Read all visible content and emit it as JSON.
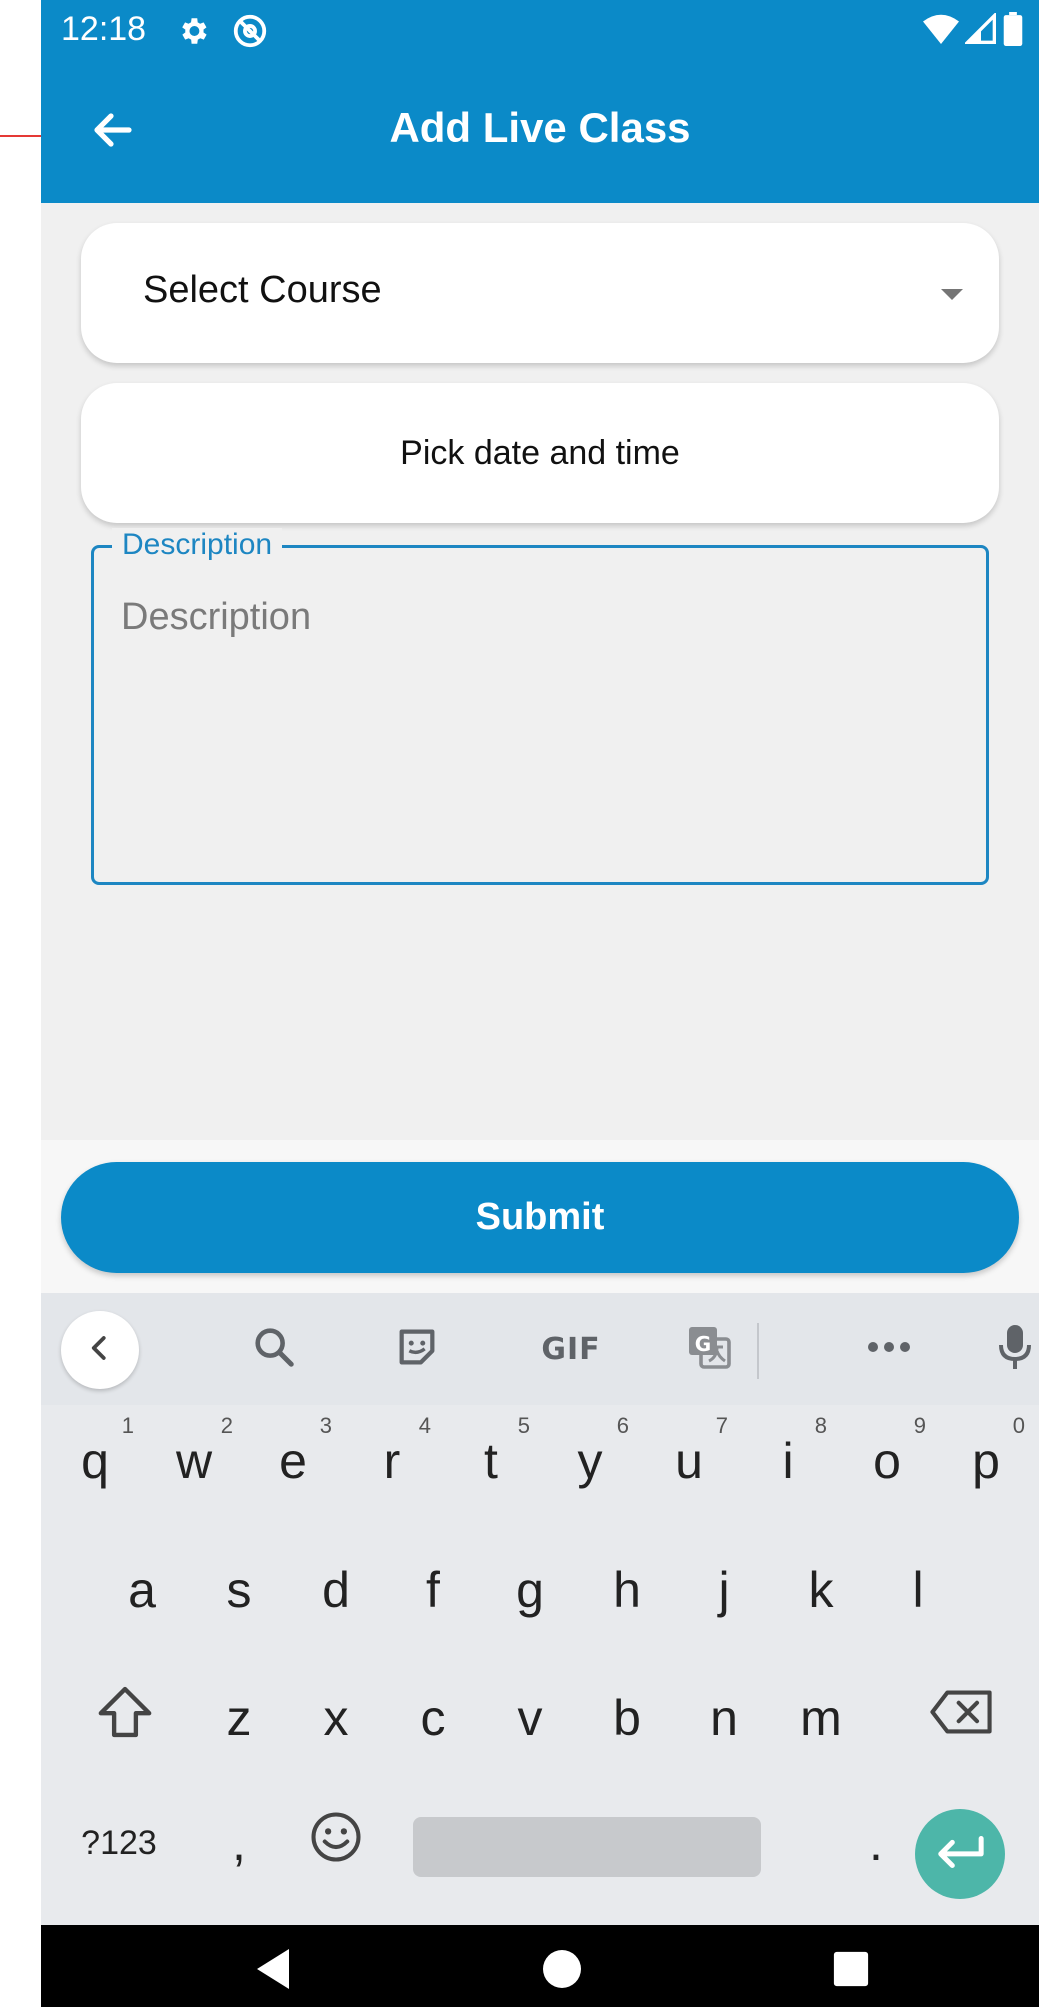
{
  "status_bar": {
    "time": "12:18",
    "left_icons": [
      "gear-icon",
      "at-sign-icon"
    ],
    "right_icons": [
      "wifi-icon",
      "signal-icon",
      "battery-icon"
    ]
  },
  "app_bar": {
    "title": "Add Live Class",
    "back_icon": "arrow-left-icon"
  },
  "form": {
    "course_select": {
      "label": "Select Course",
      "icon": "dropdown-arrow-icon"
    },
    "date_picker": {
      "label": "Pick date and time"
    },
    "description": {
      "legend": "Description",
      "placeholder": "Description",
      "value": ""
    },
    "submit_label": "Submit"
  },
  "keyboard": {
    "toolbar": [
      "chevron-left-icon",
      "search-icon",
      "sticker-icon",
      "gif",
      "translate-icon",
      "more-icon",
      "microphone-icon"
    ],
    "gif_label": "GIF",
    "row1": [
      {
        "key": "q",
        "hint": "1"
      },
      {
        "key": "w",
        "hint": "2"
      },
      {
        "key": "e",
        "hint": "3"
      },
      {
        "key": "r",
        "hint": "4"
      },
      {
        "key": "t",
        "hint": "5"
      },
      {
        "key": "y",
        "hint": "6"
      },
      {
        "key": "u",
        "hint": "7"
      },
      {
        "key": "i",
        "hint": "8"
      },
      {
        "key": "o",
        "hint": "9"
      },
      {
        "key": "p",
        "hint": "0"
      }
    ],
    "row2": [
      "a",
      "s",
      "d",
      "f",
      "g",
      "h",
      "j",
      "k",
      "l"
    ],
    "row3": [
      "z",
      "x",
      "c",
      "v",
      "b",
      "n",
      "m"
    ],
    "row4": {
      "symbols": "?123",
      "comma": ",",
      "period": "."
    },
    "colors": {
      "enter": "#4db6a9",
      "accent": "#0b8ac8"
    }
  },
  "nav_bar": [
    "back-triangle-icon",
    "home-circle-icon",
    "recents-square-icon"
  ]
}
